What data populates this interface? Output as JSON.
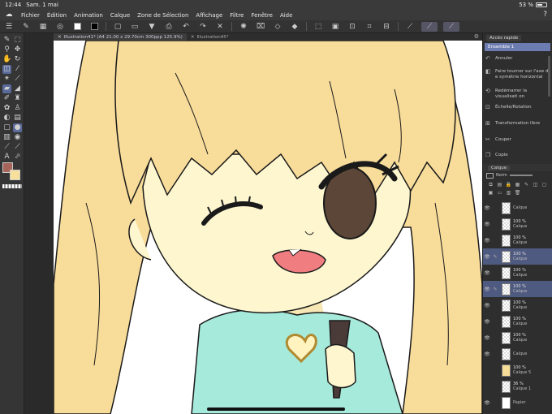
{
  "status": {
    "time": "12:44",
    "date": "Sam. 1 mai",
    "battery": "53 %"
  },
  "menu": [
    "Fichier",
    "Édition",
    "Animation",
    "Calque",
    "Zone de Sélection",
    "Affichage",
    "Filtre",
    "Fenêtre",
    "Aide"
  ],
  "tabs": [
    {
      "label": "Illustration41* (A4 21.00 x 29.70cm 300ppp 125.9%)",
      "active": true
    },
    {
      "label": "Illustration45*",
      "active": false
    }
  ],
  "quick_access": {
    "tab_label": "Accès rapide",
    "set_label": "Ensemble 1",
    "items": [
      {
        "label": "Annuler",
        "icon": "undo-icon"
      },
      {
        "label": "Faire tourner sur l'axe d e symétrie horizontal",
        "icon": "flip-horizontal-icon"
      },
      {
        "label": "Redémarrer la visualisati on",
        "icon": "reset-view-icon"
      },
      {
        "label": "Échelle/Rotation",
        "icon": "scale-rotate-icon"
      },
      {
        "label": "Transformation libre",
        "icon": "free-transform-icon"
      },
      {
        "label": "Couper",
        "icon": "cut-icon"
      },
      {
        "label": "Copie",
        "icon": "copy-icon"
      }
    ]
  },
  "layer_panel": {
    "tab_label": "Calque",
    "blend_mode": "Norm",
    "layers": [
      {
        "opacity": "",
        "name": "Calque",
        "thumb": "checker",
        "visible": true,
        "selected": false
      },
      {
        "opacity": "100 %",
        "name": "Calque",
        "thumb": "checker",
        "visible": true,
        "selected": false
      },
      {
        "opacity": "100 %",
        "name": "Calque",
        "thumb": "checker",
        "visible": true,
        "selected": false
      },
      {
        "opacity": "100 %",
        "name": "Calque",
        "thumb": "checker",
        "visible": true,
        "selected": true
      },
      {
        "opacity": "100 %",
        "name": "Calque",
        "thumb": "checker",
        "visible": true,
        "selected": false
      },
      {
        "opacity": "100 %",
        "name": "Calque",
        "thumb": "checker",
        "visible": true,
        "selected": true
      },
      {
        "opacity": "100 %",
        "name": "Calque",
        "thumb": "checker",
        "visible": true,
        "selected": false
      },
      {
        "opacity": "100 %",
        "name": "Calque",
        "thumb": "checker",
        "visible": true,
        "selected": false
      },
      {
        "opacity": "100 %",
        "name": "Calque",
        "thumb": "checker",
        "visible": true,
        "selected": false
      },
      {
        "opacity": "",
        "name": "Calque",
        "thumb": "checker",
        "visible": true,
        "selected": false
      },
      {
        "opacity": "100 %",
        "name": "Calque 5",
        "thumb": "yellow",
        "visible": false,
        "selected": false
      },
      {
        "opacity": "36 %",
        "name": "Calque 1",
        "thumb": "checker",
        "visible": false,
        "selected": false
      },
      {
        "opacity": "",
        "name": "Papier",
        "thumb": "white",
        "visible": true,
        "selected": false
      }
    ]
  },
  "colors": {
    "main": "#a7645a",
    "sub": "#f6e09c",
    "accent": "#6c7bb0",
    "hair": "#f8dc9a",
    "skin": "#fdf6cf",
    "shirt": "#a6eadb"
  }
}
